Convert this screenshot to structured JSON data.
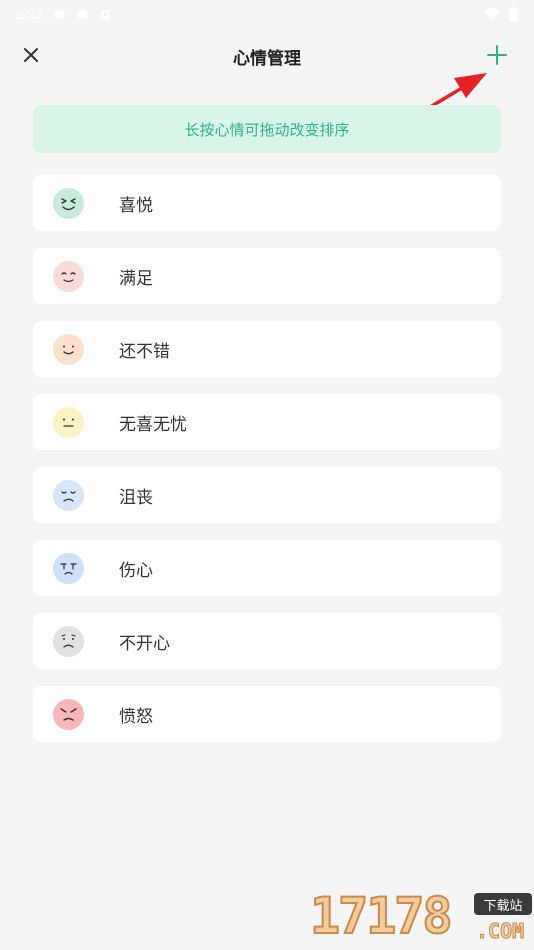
{
  "status_bar": {
    "time": "9:23"
  },
  "header": {
    "title": "心情管理"
  },
  "hint": {
    "text": "长按心情可拖动改变排序"
  },
  "moods": [
    {
      "label": "喜悦",
      "face_color": "#c7ecdb",
      "icon": "grin-face-icon"
    },
    {
      "label": "满足",
      "face_color": "#fbdada",
      "icon": "content-face-icon"
    },
    {
      "label": "还不错",
      "face_color": "#fde1cc",
      "icon": "smile-face-icon"
    },
    {
      "label": "无喜无忧",
      "face_color": "#fdf3c2",
      "icon": "neutral-face-icon"
    },
    {
      "label": "沮丧",
      "face_color": "#d6e6fb",
      "icon": "dejected-face-icon"
    },
    {
      "label": "伤心",
      "face_color": "#cfe0fb",
      "icon": "sad-face-icon"
    },
    {
      "label": "不开心",
      "face_color": "#e2e2e2",
      "icon": "unhappy-face-icon"
    },
    {
      "label": "愤怒",
      "face_color": "#fbb7b7",
      "icon": "angry-face-icon"
    }
  ],
  "colors": {
    "accent": "#2fb383",
    "banner_bg": "#d9f5ea",
    "background": "#f5f5f5"
  },
  "watermark": {
    "number": "17178",
    "tag": "下载站",
    "suffix": ".COM"
  }
}
